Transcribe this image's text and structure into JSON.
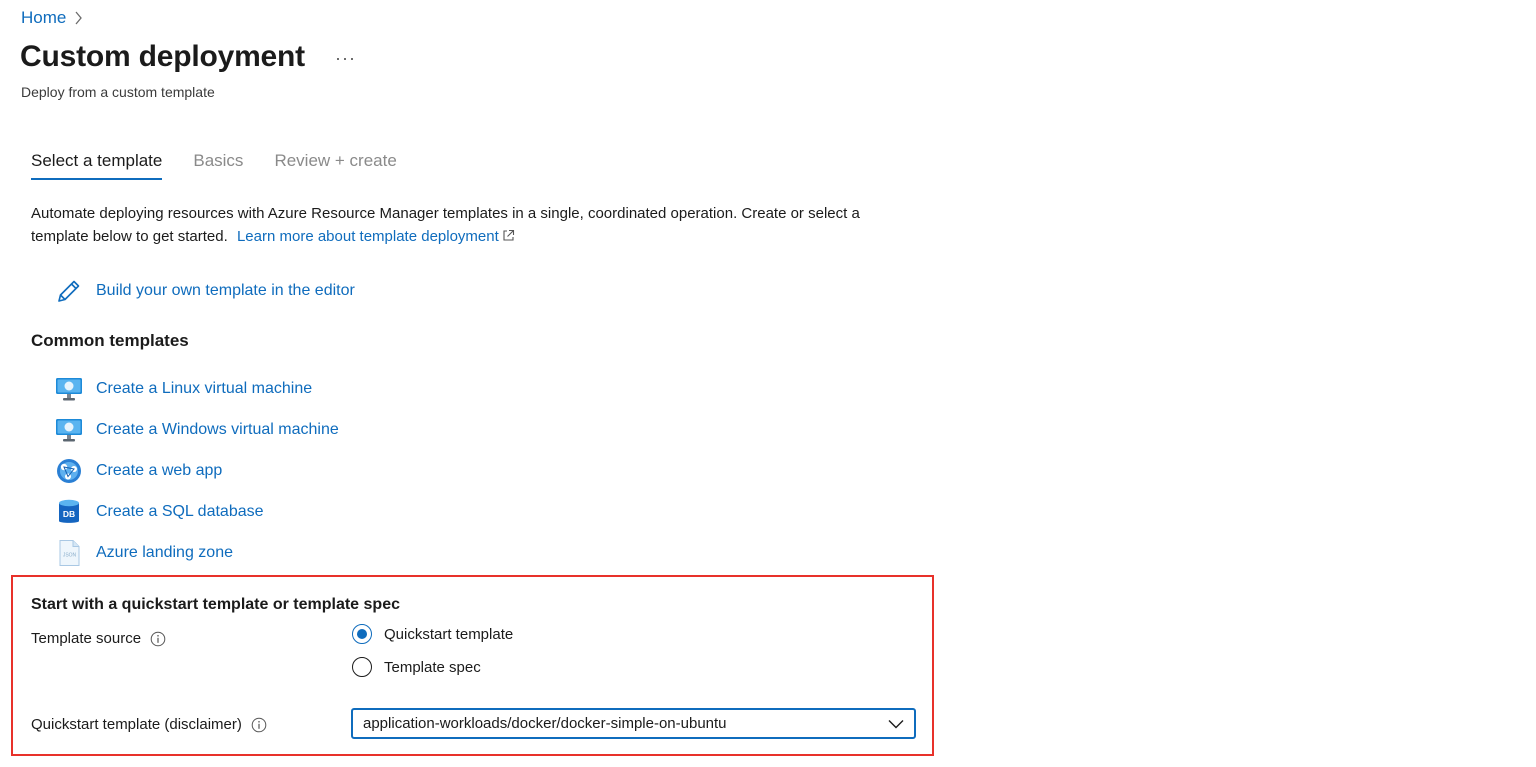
{
  "breadcrumb": {
    "home": "Home"
  },
  "header": {
    "title": "Custom deployment",
    "more_label": "···",
    "subtitle": "Deploy from a custom template"
  },
  "tabs": [
    {
      "label": "Select a template",
      "active": true
    },
    {
      "label": "Basics",
      "active": false
    },
    {
      "label": "Review + create",
      "active": false
    }
  ],
  "description": {
    "text": "Automate deploying resources with Azure Resource Manager templates in a single, coordinated operation. Create or select a template below to get started.",
    "link_text": "Learn more about template deployment"
  },
  "build_own": {
    "label": "Build your own template in the editor",
    "icon": "pencil-icon"
  },
  "common_templates": {
    "heading": "Common templates",
    "items": [
      {
        "label": "Create a Linux virtual machine",
        "icon": "virtual-machine-icon"
      },
      {
        "label": "Create a Windows virtual machine",
        "icon": "virtual-machine-icon"
      },
      {
        "label": "Create a web app",
        "icon": "web-app-icon"
      },
      {
        "label": "Create a SQL database",
        "icon": "sql-database-icon"
      },
      {
        "label": "Azure landing zone",
        "icon": "json-file-icon"
      }
    ]
  },
  "quickstart": {
    "heading": "Start with a quickstart template or template spec",
    "template_source_label": "Template source",
    "options": [
      {
        "label": "Quickstart template",
        "checked": true
      },
      {
        "label": "Template spec",
        "checked": false
      }
    ],
    "template_label": "Quickstart template (disclaimer)",
    "selected_template": "application-workloads/docker/docker-simple-on-ubuntu"
  },
  "colors": {
    "accent": "#0f6cbd",
    "highlight_border": "#e8312a",
    "text": "#1b1b1b",
    "muted_text": "#8a8a8a"
  }
}
